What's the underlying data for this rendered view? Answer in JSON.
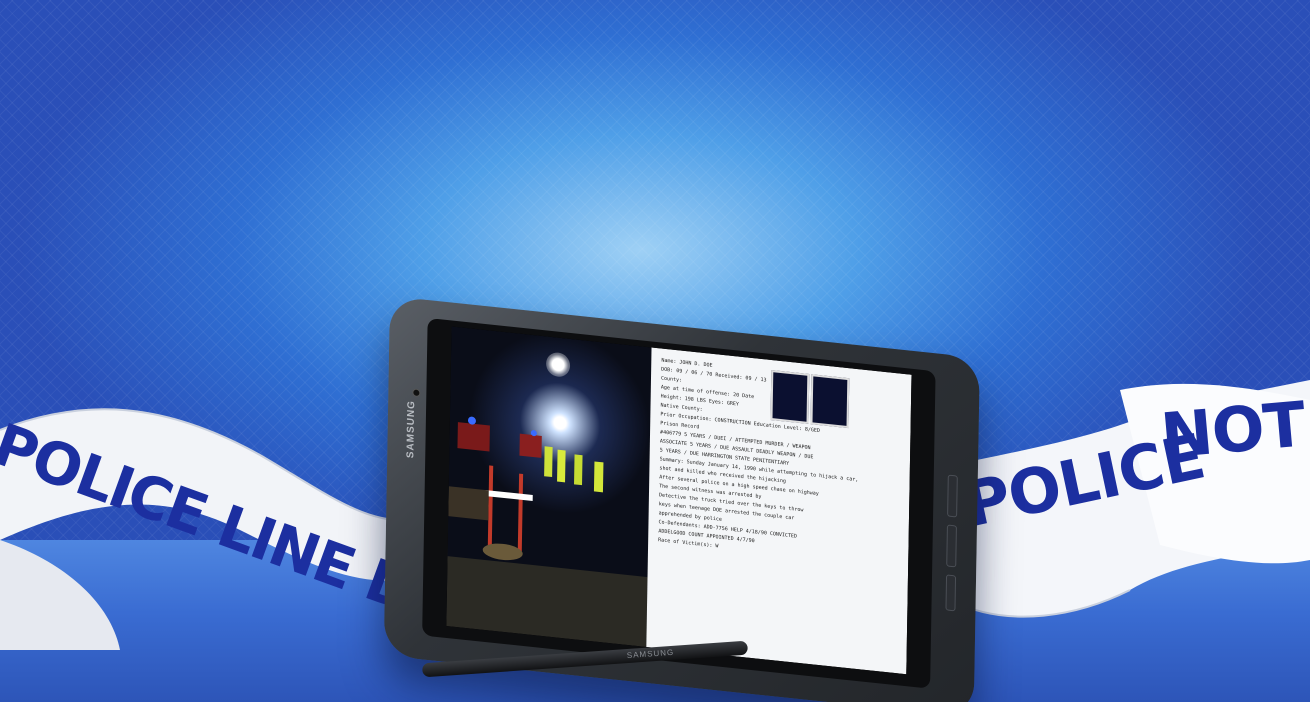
{
  "scene": {
    "tape_left_text": "POLICE LINE DO NO",
    "tape_right_text_1": "POLICE",
    "tape_right_text_2": "NOT C",
    "tablet_brand": "SAMSUNG",
    "stylus_brand": "SAMSUNG"
  },
  "document": {
    "lines": [
      "Name:   JOHN D. DOE",
      "DOB:  09 / 06 / 70        Received: 09 / 13",
      "County:",
      "Age at time of offense:  20           Date",
      "Height:  198 LBS         Eyes:  GREY",
      "Native County:",
      "Prior Occupation:  CONSTRUCTION     Education Level: 8/GED",
      "Prison Record",
      "#406779 5 YEARS / DUEI / ATTEMPTED MURDER / WEAPON",
      "ASSOCIATE 5 YEARS / DUE  ASSAULT  DEADLY WEAPON / DUE",
      "           5 YEARS / DUE  HARRINGTON STATE PENITENTIARY",
      "Summary:   Sunday January 14, 1990 while attempting to hijack a car,",
      "   shot and killed           who received the hijacking",
      "   After several police on a high speed chase on highway",
      "   The second witness was arrested by",
      "   Detective the truck tried over the keys to throw",
      "   keys when teenage DOE arrested the couple car",
      "   apprehended by police",
      "Co-Defendants:   ADD-7756 HELP   4/18/90   CONVICTED",
      "ADDELGOOD COUNT APPOINTED   4/7/90",
      "Race of Victim(s):  W"
    ]
  }
}
